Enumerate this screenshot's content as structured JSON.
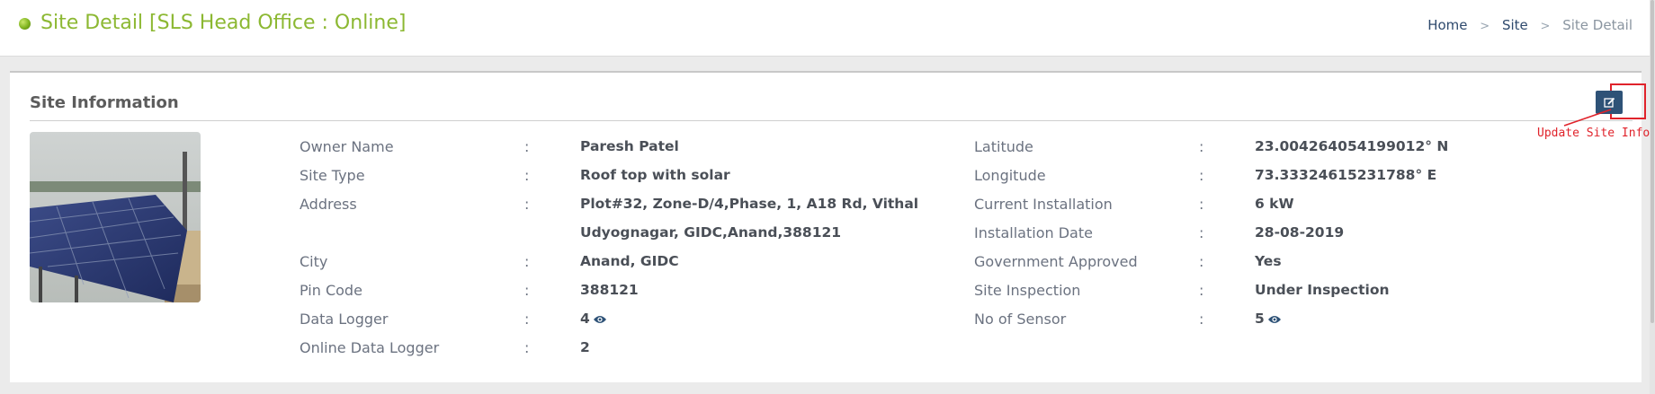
{
  "header": {
    "title": "Site Detail [SLS Head Office : Online]",
    "status_color": "#7fb31f",
    "breadcrumb": [
      "Home",
      "Site",
      "Site Detail"
    ]
  },
  "card": {
    "title": "Site Information",
    "update_label": "Update Site Info",
    "edit_icon": "edit-icon"
  },
  "left_fields": [
    {
      "label": "Owner Name",
      "value": "Paresh Patel"
    },
    {
      "label": "Site Type",
      "value": "Roof top with solar"
    },
    {
      "label": "Address",
      "value": "Plot#32, Zone-D/4,Phase, 1, A18 Rd, Vithal",
      "value2": "Udyognagar, GIDC,Anand,388121"
    },
    {
      "label": "City",
      "value": "Anand, GIDC"
    },
    {
      "label": "Pin Code",
      "value": "388121"
    },
    {
      "label": "Data Logger",
      "value": "4"
    },
    {
      "label": "Online Data Logger",
      "value": "2"
    }
  ],
  "right_fields": [
    {
      "label": "Latitude",
      "value": "23.004264054199012° N"
    },
    {
      "label": "Longitude",
      "value": "73.33324615231788° E"
    },
    {
      "label": "Current Installation",
      "value": "6 kW"
    },
    {
      "label": "Installation Date",
      "value": "28-08-2019"
    },
    {
      "label": "Government Approved",
      "value": "Yes"
    },
    {
      "label": "Site Inspection",
      "value": "Under Inspection"
    },
    {
      "label": "No of Sensor",
      "value": "5"
    }
  ],
  "colon": ":",
  "colors": {
    "accent_green": "#8cb832",
    "callout_red": "#e0232b",
    "button_blue": "#2e5277"
  }
}
